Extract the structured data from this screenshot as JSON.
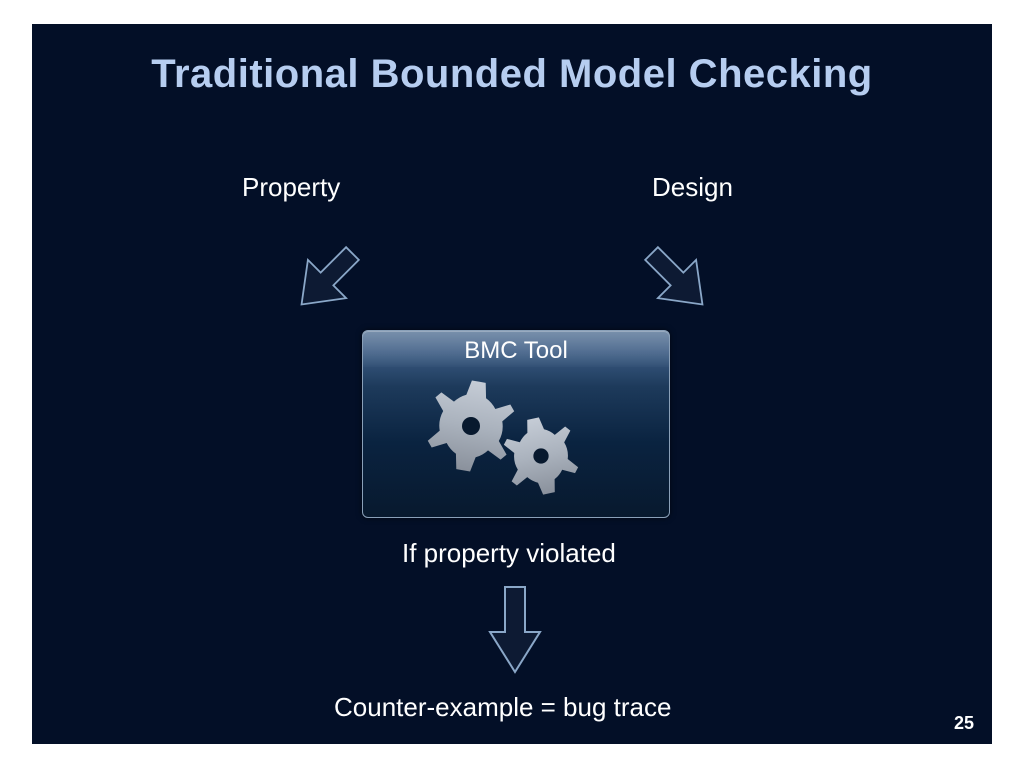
{
  "title": "Traditional Bounded Model Checking",
  "labels": {
    "property": "Property",
    "design": "Design",
    "bmc": "BMC Tool",
    "violated": "If property violated",
    "counter": "Counter-example = bug trace"
  },
  "slide_number": "25",
  "colors": {
    "background": "#030f27",
    "title": "#b6cdf0",
    "arrow_fill": "#0d1a33",
    "arrow_stroke": "#8aa7c8",
    "gear": "#aab2bd"
  }
}
